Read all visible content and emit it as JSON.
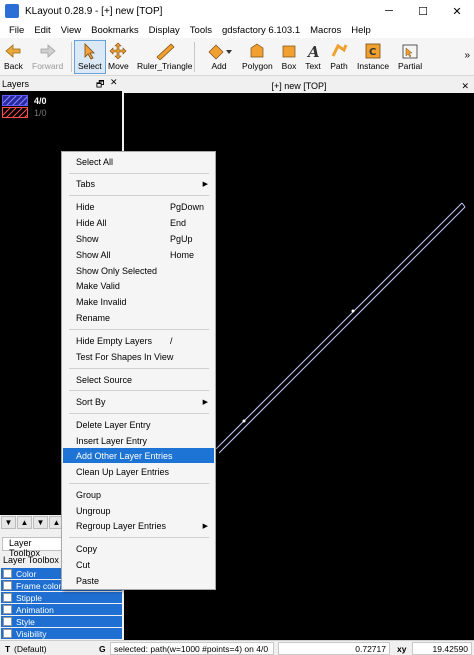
{
  "window": {
    "title": "KLayout 0.28.9 - [+] new [TOP]",
    "minimize": "─",
    "maximize": "☐",
    "close": "✕"
  },
  "menubar": [
    "File",
    "Edit",
    "View",
    "Bookmarks",
    "Display",
    "Tools",
    "gdsfactory 6.103.1",
    "Macros",
    "Help"
  ],
  "toolbar": {
    "back": "Back",
    "forward": "Forward",
    "select": "Select",
    "move": "Move",
    "ruler": "Ruler_Triangle",
    "add": "Add",
    "polygon": "Polygon",
    "box": "Box",
    "text": "Text",
    "path": "Path",
    "instance": "Instance",
    "partial": "Partial",
    "more": "»"
  },
  "layers": {
    "header": "Layers",
    "float": "🗗",
    "close": "✕",
    "items": [
      {
        "name": "4/0",
        "hatch_color": "#5a5aff"
      },
      {
        "name": "1/0",
        "hatch_color": "#ff5050"
      }
    ]
  },
  "layer_nav": [
    "▼",
    "▲",
    "▼",
    "▲",
    "◆"
  ],
  "toolbox": {
    "tab": "Layer Toolbox",
    "label": "Layer Toolbox",
    "items": [
      "Color",
      "Frame color",
      "Stipple",
      "Animation",
      "Style",
      "Visibility"
    ]
  },
  "canvas": {
    "tab": "[+] new [TOP]",
    "close": "✕",
    "path_color": "#c8c8ff"
  },
  "status": {
    "t_key": "T",
    "default_text": "(Default)",
    "g_key": "G",
    "message": "selected: path(w=1000 #points=4) on 4/0",
    "x_value": "0.72717",
    "xy_key": "xy",
    "y_value": "19.42590"
  },
  "context_menu": {
    "select_all": "Select All",
    "tabs": "Tabs",
    "hide": "Hide",
    "hide_sc": "PgDown",
    "hide_all": "Hide All",
    "hide_all_sc": "End",
    "show": "Show",
    "show_sc": "PgUp",
    "show_all": "Show All",
    "show_all_sc": "Home",
    "show_only_selected": "Show Only Selected",
    "make_valid": "Make Valid",
    "make_invalid": "Make Invalid",
    "rename": "Rename",
    "hide_empty": "Hide Empty Layers",
    "hide_empty_sc": "/",
    "test_shapes": "Test For Shapes In View",
    "select_source": "Select Source",
    "sort_by": "Sort By",
    "delete_entry": "Delete Layer Entry",
    "insert_entry": "Insert Layer Entry",
    "add_other": "Add Other Layer Entries",
    "clean_up": "Clean Up Layer Entries",
    "group": "Group",
    "ungroup": "Ungroup",
    "regroup": "Regroup Layer Entries",
    "copy": "Copy",
    "cut": "Cut",
    "paste": "Paste",
    "submenu_arrow": "▶"
  }
}
